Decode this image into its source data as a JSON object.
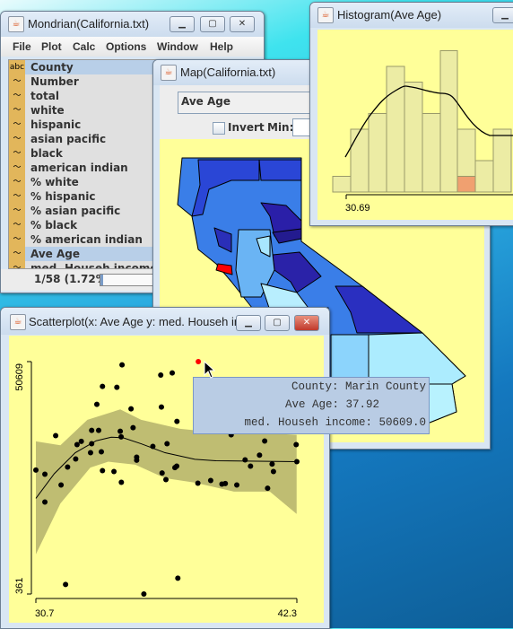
{
  "mondrian": {
    "title": "Mondrian(California.txt)",
    "menu": [
      "File",
      "Plot",
      "Calc",
      "Options",
      "Window",
      "Help"
    ],
    "variables": [
      {
        "label": "County",
        "type": "abc",
        "selected": true
      },
      {
        "label": "Number",
        "type": "numeric"
      },
      {
        "label": "total",
        "type": "numeric"
      },
      {
        "label": "white",
        "type": "numeric"
      },
      {
        "label": "hispanic",
        "type": "numeric"
      },
      {
        "label": "asian pacific",
        "type": "numeric"
      },
      {
        "label": "black",
        "type": "numeric"
      },
      {
        "label": "american indian",
        "type": "numeric"
      },
      {
        "label": "% white",
        "type": "numeric"
      },
      {
        "label": "% hispanic",
        "type": "numeric"
      },
      {
        "label": "% asian pacific",
        "type": "numeric"
      },
      {
        "label": "% black",
        "type": "numeric"
      },
      {
        "label": "% american indian",
        "type": "numeric"
      },
      {
        "label": "Ave Age",
        "type": "numeric",
        "selected": true
      },
      {
        "label": "med. Househ income",
        "type": "numeric"
      }
    ],
    "abc_icon_text": "abc",
    "status": "1/58 (1.72%)",
    "selection_fraction": 0.0172
  },
  "map": {
    "title": "Map(California.txt)",
    "variable_select": "Ave Age",
    "invert_label": "Invert",
    "invert_checked": false,
    "min_label": "Min:",
    "min_value": "",
    "highlight_color": "#ff0000"
  },
  "histogram": {
    "title": "Histogram(Ave Age)",
    "chart_data": {
      "type": "bar",
      "variable": "Ave Age",
      "axis_start_label": "30.69",
      "counts": [
        1,
        4,
        5,
        8,
        7,
        5,
        9,
        4,
        2,
        4
      ],
      "highlighted_counts": [
        0,
        0,
        0,
        0,
        0,
        0,
        0,
        1,
        0,
        0
      ],
      "bar_color": "#ececa4",
      "highlight_color": "#f0a070",
      "density_curve": true
    }
  },
  "scatterplot": {
    "title": "Scatterplot(x: Ave Age y: med. Househ in...",
    "chart_data": {
      "type": "scatter",
      "xlabel_min": "30.7",
      "xlabel_max": "42.3",
      "ylabel_min": "361",
      "ylabel_max": "50609",
      "xlim": [
        30.7,
        42.3
      ],
      "ylim": [
        361,
        50609
      ],
      "points": [
        [
          30.7,
          27164
        ],
        [
          31.1,
          26260
        ],
        [
          31.1,
          20253
        ],
        [
          31.58,
          34592
        ],
        [
          31.82,
          23935
        ],
        [
          32.02,
          2428
        ],
        [
          32.11,
          27810
        ],
        [
          32.47,
          29554
        ],
        [
          32.53,
          32654
        ],
        [
          32.72,
          33364
        ],
        [
          33.13,
          30910
        ],
        [
          33.18,
          35754
        ],
        [
          33.18,
          32848
        ],
        [
          33.41,
          41373
        ],
        [
          33.49,
          35754
        ],
        [
          33.61,
          31104
        ],
        [
          33.66,
          45248
        ],
        [
          33.66,
          27035
        ],
        [
          34.17,
          26841
        ],
        [
          34.3,
          45055
        ],
        [
          34.45,
          35560
        ],
        [
          34.49,
          34333
        ],
        [
          34.5,
          24516
        ],
        [
          34.53,
          49898
        ],
        [
          34.93,
          40404
        ],
        [
          35.02,
          36335
        ],
        [
          35.18,
          29941
        ],
        [
          35.18,
          29296
        ],
        [
          35.5,
          361
        ],
        [
          35.9,
          32266
        ],
        [
          36.25,
          47703
        ],
        [
          36.28,
          40792
        ],
        [
          36.31,
          26518
        ],
        [
          36.48,
          25097
        ],
        [
          36.53,
          32848
        ],
        [
          36.76,
          48155
        ],
        [
          36.88,
          27681
        ],
        [
          36.96,
          28004
        ],
        [
          36.97,
          37692
        ],
        [
          37.01,
          3784
        ],
        [
          37.9,
          24322
        ],
        [
          38.47,
          24904
        ],
        [
          38.97,
          24129
        ],
        [
          39.12,
          24258
        ],
        [
          39.38,
          34785
        ],
        [
          39.63,
          23935
        ],
        [
          40.0,
          29360
        ],
        [
          40.24,
          28004
        ],
        [
          40.64,
          30393
        ],
        [
          40.87,
          33429
        ],
        [
          41.0,
          23224
        ],
        [
          41.2,
          28456
        ],
        [
          41.26,
          26841
        ],
        [
          42.27,
          32654
        ],
        [
          42.3,
          28973
        ]
      ],
      "highlighted_point": [
        37.92,
        50609
      ],
      "point_color": "#000000",
      "highlight_color": "#ff0000",
      "smoother": {
        "line": [
          [
            30.7,
            21029
          ],
          [
            31.52,
            26389
          ],
          [
            32.45,
            30910
          ],
          [
            33.38,
            33494
          ],
          [
            34.05,
            34269
          ],
          [
            34.58,
            34140
          ],
          [
            35.38,
            32848
          ],
          [
            36.44,
            30910
          ],
          [
            37.77,
            29490
          ],
          [
            38.7,
            29166
          ],
          [
            42.29,
            28973
          ]
        ],
        "upper": [
          [
            30.7,
            33364
          ],
          [
            31.79,
            32525
          ],
          [
            32.99,
            38015
          ],
          [
            34.45,
            40275
          ],
          [
            35.38,
            38015
          ],
          [
            37.11,
            36077
          ],
          [
            38.44,
            35431
          ],
          [
            39.77,
            35431
          ],
          [
            42.29,
            34785
          ]
        ],
        "lower": [
          [
            30.7,
            8951
          ],
          [
            31.79,
            19931
          ],
          [
            33.12,
            27681
          ],
          [
            33.92,
            28973
          ],
          [
            35.12,
            28327
          ],
          [
            36.44,
            25420
          ],
          [
            37.77,
            24451
          ],
          [
            39.5,
            22514
          ],
          [
            41.1,
            22514
          ],
          [
            42.29,
            17670
          ]
        ],
        "band_color": "#bfbd72"
      }
    },
    "tooltip": {
      "line1": "County: Marin County",
      "line2": "Ave Age: 37.92",
      "line3": "med. Househ income: 50609.0"
    }
  },
  "window_buttons": {
    "minimize": "▁",
    "maximize": "▢",
    "close": "✕"
  }
}
